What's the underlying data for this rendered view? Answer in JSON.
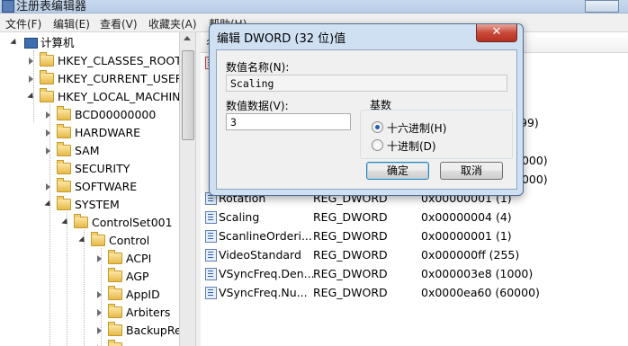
{
  "window": {
    "title": "注册表编辑器"
  },
  "menubar": {
    "items": [
      "文件(F)",
      "编辑(E)",
      "查看(V)",
      "收藏夹(A)",
      "帮助(H)"
    ]
  },
  "tree": {
    "items": [
      {
        "label": "计算机",
        "depth": 0,
        "expanded": true,
        "icon": "computer-icon"
      },
      {
        "label": "HKEY_CLASSES_ROOT",
        "depth": 1,
        "expanded": false
      },
      {
        "label": "HKEY_CURRENT_USER",
        "depth": 1,
        "expanded": false
      },
      {
        "label": "HKEY_LOCAL_MACHINE",
        "depth": 1,
        "expanded": true
      },
      {
        "label": "BCD00000000",
        "depth": 2,
        "expanded": false
      },
      {
        "label": "HARDWARE",
        "depth": 2,
        "expanded": false
      },
      {
        "label": "SAM",
        "depth": 2,
        "expanded": false
      },
      {
        "label": "SECURITY",
        "depth": 2,
        "expanded": false
      },
      {
        "label": "SOFTWARE",
        "depth": 2,
        "expanded": false
      },
      {
        "label": "SYSTEM",
        "depth": 2,
        "expanded": true
      },
      {
        "label": "ControlSet001",
        "depth": 3,
        "expanded": true
      },
      {
        "label": "Control",
        "depth": 4,
        "expanded": true
      },
      {
        "label": "ACPI",
        "depth": 5,
        "expanded": false
      },
      {
        "label": "AGP",
        "depth": 5,
        "expanded": false
      },
      {
        "label": "AppID",
        "depth": 5,
        "expanded": false
      },
      {
        "label": "Arbiters",
        "depth": 5,
        "expanded": false
      },
      {
        "label": "BackupRe",
        "depth": 5,
        "expanded": false
      }
    ]
  },
  "values_pane": {
    "header_partial": "名",
    "top_partial_data": [
      "99)",
      "0000)",
      "0000)"
    ],
    "rows": [
      {
        "name": "Rotation",
        "type": "REG_DWORD",
        "data": "0x00000001 (1)"
      },
      {
        "name": "Scaling",
        "type": "REG_DWORD",
        "data": "0x00000004 (4)"
      },
      {
        "name": "ScanlineOrderi...",
        "type": "REG_DWORD",
        "data": "0x00000001 (1)"
      },
      {
        "name": "VideoStandard",
        "type": "REG_DWORD",
        "data": "0x000000ff (255)"
      },
      {
        "name": "VSyncFreq.Den...",
        "type": "REG_DWORD",
        "data": "0x000003e8 (1000)"
      },
      {
        "name": "VSyncFreq.Nu...",
        "type": "REG_DWORD",
        "data": "0x0000ea60 (60000)"
      }
    ]
  },
  "dialog": {
    "title": "编辑 DWORD (32 位)值",
    "close_label": "✕",
    "name_label": "数值名称(N):",
    "name_value": "Scaling",
    "data_label": "数值数据(V):",
    "data_value": "3",
    "base_label": "基数",
    "radio_hex": "十六进制(H)",
    "radio_dec": "十进制(D)",
    "selected_base": "hex",
    "ok_label": "确定",
    "cancel_label": "取消"
  }
}
